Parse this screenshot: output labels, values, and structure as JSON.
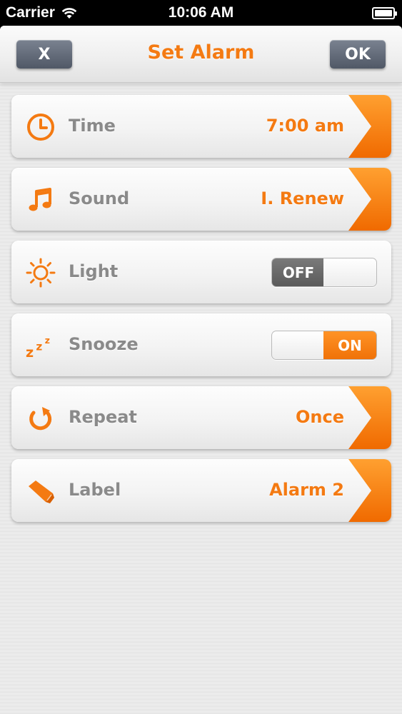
{
  "status_bar": {
    "carrier": "Carrier",
    "time": "10:06 AM",
    "battery_level": 1.0
  },
  "nav": {
    "close_label": "X",
    "title": "Set Alarm",
    "ok_label": "OK"
  },
  "rows": {
    "time": {
      "label": "Time",
      "value": "7:00 am",
      "icon": "clock-icon"
    },
    "sound": {
      "label": "Sound",
      "value": "I. Renew",
      "icon": "music-note-icon"
    },
    "light": {
      "label": "Light",
      "toggle_text": "OFF",
      "state": "off",
      "icon": "sun-icon"
    },
    "snooze": {
      "label": "Snooze",
      "toggle_text": "ON",
      "state": "on",
      "icon": "zzz-icon"
    },
    "repeat": {
      "label": "Repeat",
      "value": "Once",
      "icon": "repeat-icon"
    },
    "label": {
      "label": "Label",
      "value": "Alarm 2",
      "icon": "tag-icon"
    }
  },
  "colors": {
    "accent": "#f47a12",
    "label_gray": "#8a8a8a",
    "button_slate": "#5e6675"
  }
}
